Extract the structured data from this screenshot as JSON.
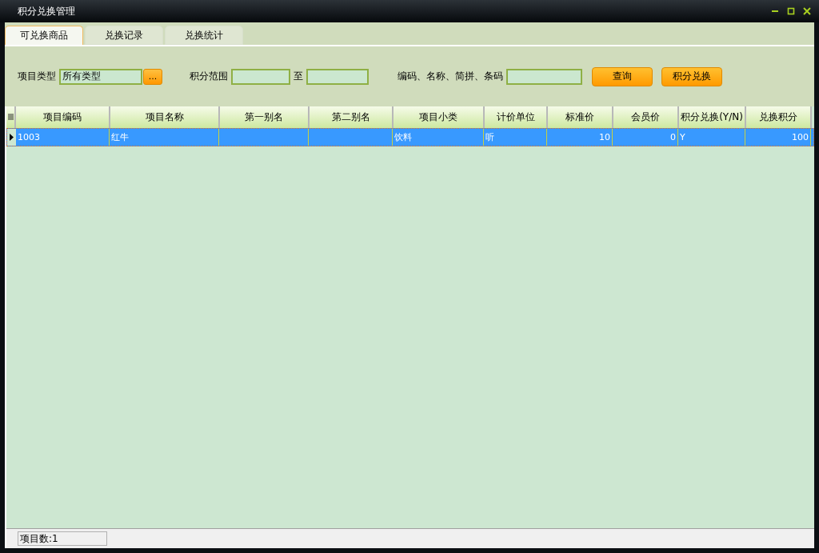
{
  "window": {
    "title": "积分兑换管理"
  },
  "tabs": [
    {
      "label": "可兑换商品",
      "selected": true
    },
    {
      "label": "兑换记录",
      "selected": false
    },
    {
      "label": "兑换统计",
      "selected": false
    }
  ],
  "filters": {
    "type_label": "项目类型",
    "type_value": "所有类型",
    "browse_button": "...",
    "range_label": "积分范围",
    "range_to": "至",
    "search_label": "编码、名称、简拼、条码",
    "query_button": "查询",
    "redeem_button": "积分兑换"
  },
  "table": {
    "columns": [
      "项目编码",
      "项目名称",
      "第一别名",
      "第二别名",
      "项目小类",
      "计价单位",
      "标准价",
      "会员价",
      "积分兑换(Y/N)",
      "兑换积分"
    ],
    "rows": [
      {
        "selected": true,
        "cells": [
          "1003",
          "红牛",
          "",
          "",
          "饮料",
          "听",
          "10",
          "0",
          "Y",
          "100"
        ]
      }
    ]
  },
  "status_bar": {
    "count": "项目数:1"
  }
}
